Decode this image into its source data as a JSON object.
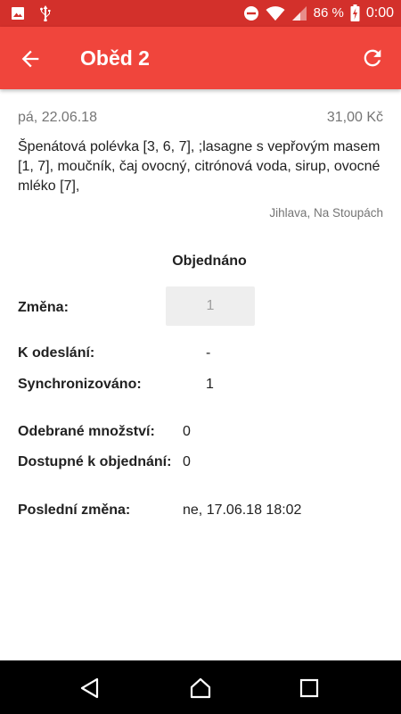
{
  "status_bar": {
    "battery": "86 %",
    "time": "0:00",
    "icons": [
      "image-icon",
      "usb-icon",
      "do-not-disturb-icon",
      "wifi-icon",
      "signal-icon",
      "battery-charging-icon"
    ]
  },
  "app_bar": {
    "title": "Oběd 2",
    "icons": [
      "back-arrow-icon",
      "refresh-icon"
    ]
  },
  "meal": {
    "date": "pá, 22.06.18",
    "price": "31,00 Kč",
    "description": "Špenátová polévka [3, 6, 7], ;lasagne s vepřovým masem [1, 7], moučník, čaj ovocný, citrónová voda, sirup, ovocné mléko [7],",
    "place": "Jihlava, Na Stoupách"
  },
  "order": {
    "status": "Objednáno",
    "change_label": "Změna:",
    "change_value": "1",
    "to_send_label": "K odeslání:",
    "to_send_value": "-",
    "synced_label": "Synchronizováno:",
    "synced_value": "1",
    "taken_label": "Odebrané množství:",
    "taken_value": "0",
    "available_label": "Dostupné k objednání:",
    "available_value": "0",
    "last_change_label": "Poslední změna:",
    "last_change_value": "ne, 17.06.18 18:02"
  },
  "nav_bar": {
    "icons": [
      "nav-back-icon",
      "nav-home-icon",
      "nav-recents-icon"
    ]
  },
  "colors": {
    "status_bar": "#d3302b",
    "app_bar": "#f0453c",
    "input_bg": "#eeeeee"
  }
}
